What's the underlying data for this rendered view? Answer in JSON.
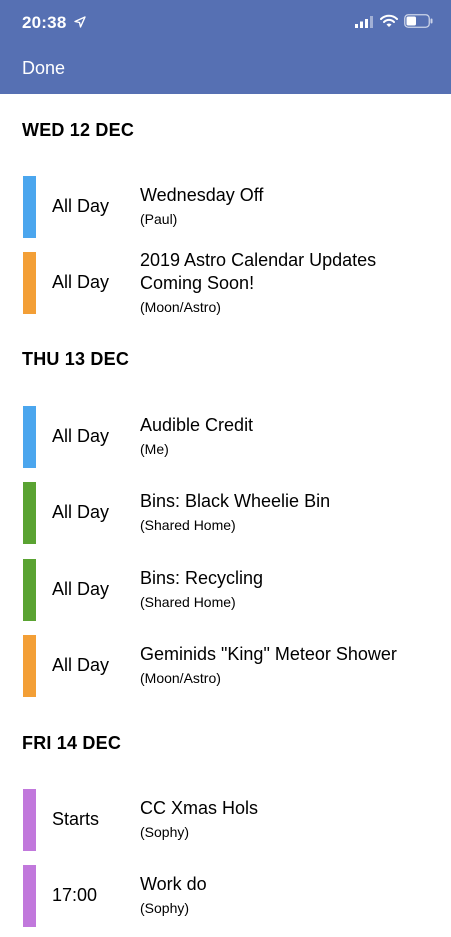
{
  "status_bar": {
    "time": "20:38"
  },
  "nav": {
    "done_label": "Done"
  },
  "days": [
    {
      "label": "WED 12 DEC"
    },
    {
      "label": "THU 13 DEC"
    },
    {
      "label": "FRI 14 DEC"
    }
  ],
  "events": [
    {
      "time": "All Day",
      "title": "Wednesday Off",
      "calendar": "(Paul)",
      "color": "#4ba6ee"
    },
    {
      "time": "All Day",
      "title": "2019 Astro Calendar Updates Coming Soon!",
      "calendar": "(Moon/Astro)",
      "color": "#f39f36"
    },
    {
      "time": "All Day",
      "title": "Audible Credit",
      "calendar": "(Me)",
      "color": "#4ba6ee"
    },
    {
      "time": "All Day",
      "title": "Bins: Black Wheelie Bin",
      "calendar": "(Shared Home)",
      "color": "#5aa332"
    },
    {
      "time": "All Day",
      "title": "Bins: Recycling",
      "calendar": "(Shared Home)",
      "color": "#5aa332"
    },
    {
      "time": "All Day",
      "title": "Geminids \"King\" Meteor Shower",
      "calendar": "(Moon/Astro)",
      "color": "#f39f36"
    },
    {
      "time": "Starts",
      "title": "CC Xmas Hols",
      "calendar": "(Sophy)",
      "color": "#c178dc"
    },
    {
      "time": "17:00",
      "title": "Work do",
      "calendar": "(Sophy)",
      "color": "#c178dc"
    }
  ]
}
